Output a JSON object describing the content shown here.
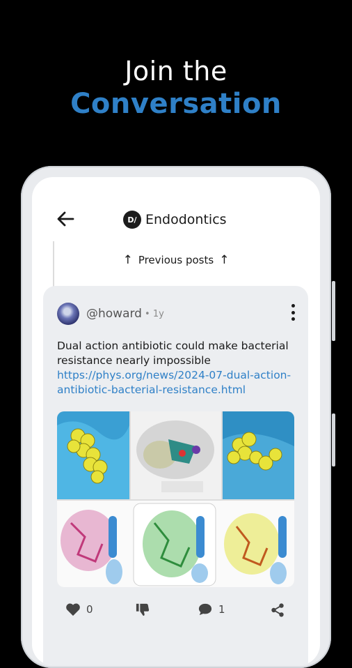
{
  "promo": {
    "line1": "Join the",
    "line2": "Conversation"
  },
  "appbar": {
    "community_badge": "D/",
    "community_name": "Endodontics"
  },
  "thread": {
    "previous_posts_label": "Previous posts"
  },
  "post": {
    "author": "@howard",
    "separator": "•",
    "age": "1y",
    "text": "Dual action antibiotic could make bacterial resistance nearly impossible",
    "link": "https://phys.org/news/2024-07-dual-action-antibiotic-bacterial-resistance.html",
    "like_count": "0",
    "comment_count": "1"
  },
  "colors": {
    "accent": "#2f80c7",
    "background": "#000000",
    "card": "#eceef1"
  },
  "icons": [
    "back-arrow-icon",
    "arrow-up-icon",
    "kebab-menu-icon",
    "heart-icon",
    "thumbs-down-icon",
    "comment-icon",
    "share-icon"
  ]
}
